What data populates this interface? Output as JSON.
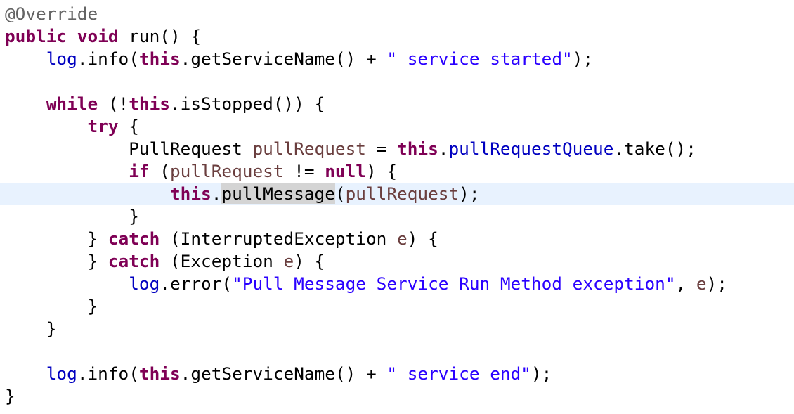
{
  "code": {
    "lines": [
      {
        "indent": "",
        "tokens": [
          {
            "t": "@Override",
            "k": "ann"
          }
        ]
      },
      {
        "indent": "",
        "tokens": [
          {
            "t": "public",
            "k": "kw"
          },
          {
            "t": " "
          },
          {
            "t": "void",
            "k": "kw"
          },
          {
            "t": " run() {"
          }
        ]
      },
      {
        "indent": "    ",
        "tokens": [
          {
            "t": "log",
            "k": "field"
          },
          {
            "t": ".info("
          },
          {
            "t": "this",
            "k": "kw"
          },
          {
            "t": ".getServiceName() + "
          },
          {
            "t": "\" service started\"",
            "k": "str"
          },
          {
            "t": ");"
          }
        ]
      },
      {
        "indent": "",
        "tokens": []
      },
      {
        "indent": "    ",
        "tokens": [
          {
            "t": "while",
            "k": "kw"
          },
          {
            "t": " (!"
          },
          {
            "t": "this",
            "k": "kw"
          },
          {
            "t": ".isStopped()) {"
          }
        ]
      },
      {
        "indent": "        ",
        "tokens": [
          {
            "t": "try",
            "k": "kw"
          },
          {
            "t": " {"
          }
        ]
      },
      {
        "indent": "            ",
        "tokens": [
          {
            "t": "PullRequest "
          },
          {
            "t": "pullRequest",
            "k": "local"
          },
          {
            "t": " = "
          },
          {
            "t": "this",
            "k": "kw"
          },
          {
            "t": "."
          },
          {
            "t": "pullRequestQueue",
            "k": "field"
          },
          {
            "t": ".take();"
          }
        ]
      },
      {
        "indent": "            ",
        "tokens": [
          {
            "t": "if",
            "k": "kw"
          },
          {
            "t": " ("
          },
          {
            "t": "pullRequest",
            "k": "local"
          },
          {
            "t": " != "
          },
          {
            "t": "null",
            "k": "kw"
          },
          {
            "t": ") {"
          }
        ]
      },
      {
        "indent": "                ",
        "current": true,
        "tokens": [
          {
            "t": "this",
            "k": "kw"
          },
          {
            "t": "."
          },
          {
            "t": "pullMessage",
            "k": "selected"
          },
          {
            "t": "("
          },
          {
            "t": "pullRequest",
            "k": "local"
          },
          {
            "t": ");"
          }
        ]
      },
      {
        "indent": "            ",
        "tokens": [
          {
            "t": "}"
          }
        ]
      },
      {
        "indent": "        ",
        "tokens": [
          {
            "t": "} "
          },
          {
            "t": "catch",
            "k": "kw"
          },
          {
            "t": " (InterruptedException "
          },
          {
            "t": "e",
            "k": "local"
          },
          {
            "t": ") {"
          }
        ]
      },
      {
        "indent": "        ",
        "tokens": [
          {
            "t": "} "
          },
          {
            "t": "catch",
            "k": "kw"
          },
          {
            "t": " (Exception "
          },
          {
            "t": "e",
            "k": "local"
          },
          {
            "t": ") {"
          }
        ]
      },
      {
        "indent": "            ",
        "tokens": [
          {
            "t": "log",
            "k": "field"
          },
          {
            "t": ".error("
          },
          {
            "t": "\"Pull Message Service Run Method exception\"",
            "k": "str"
          },
          {
            "t": ", "
          },
          {
            "t": "e",
            "k": "local"
          },
          {
            "t": ");"
          }
        ]
      },
      {
        "indent": "        ",
        "tokens": [
          {
            "t": "}"
          }
        ]
      },
      {
        "indent": "    ",
        "tokens": [
          {
            "t": "}"
          }
        ]
      },
      {
        "indent": "",
        "tokens": []
      },
      {
        "indent": "    ",
        "tokens": [
          {
            "t": "log",
            "k": "field"
          },
          {
            "t": ".info("
          },
          {
            "t": "this",
            "k": "kw"
          },
          {
            "t": ".getServiceName() + "
          },
          {
            "t": "\" service end\"",
            "k": "str"
          },
          {
            "t": ");"
          }
        ]
      },
      {
        "indent": "",
        "tokens": [
          {
            "t": "}"
          }
        ]
      }
    ]
  },
  "colors": {
    "keyword": "#7f0055",
    "annotation": "#646464",
    "string": "#2a00ff",
    "field": "#0000c0",
    "local_variable": "#6a3e3e",
    "current_line_highlight": "#e8f2fe",
    "selection": "#d4d4d4",
    "background": "#ffffff"
  }
}
